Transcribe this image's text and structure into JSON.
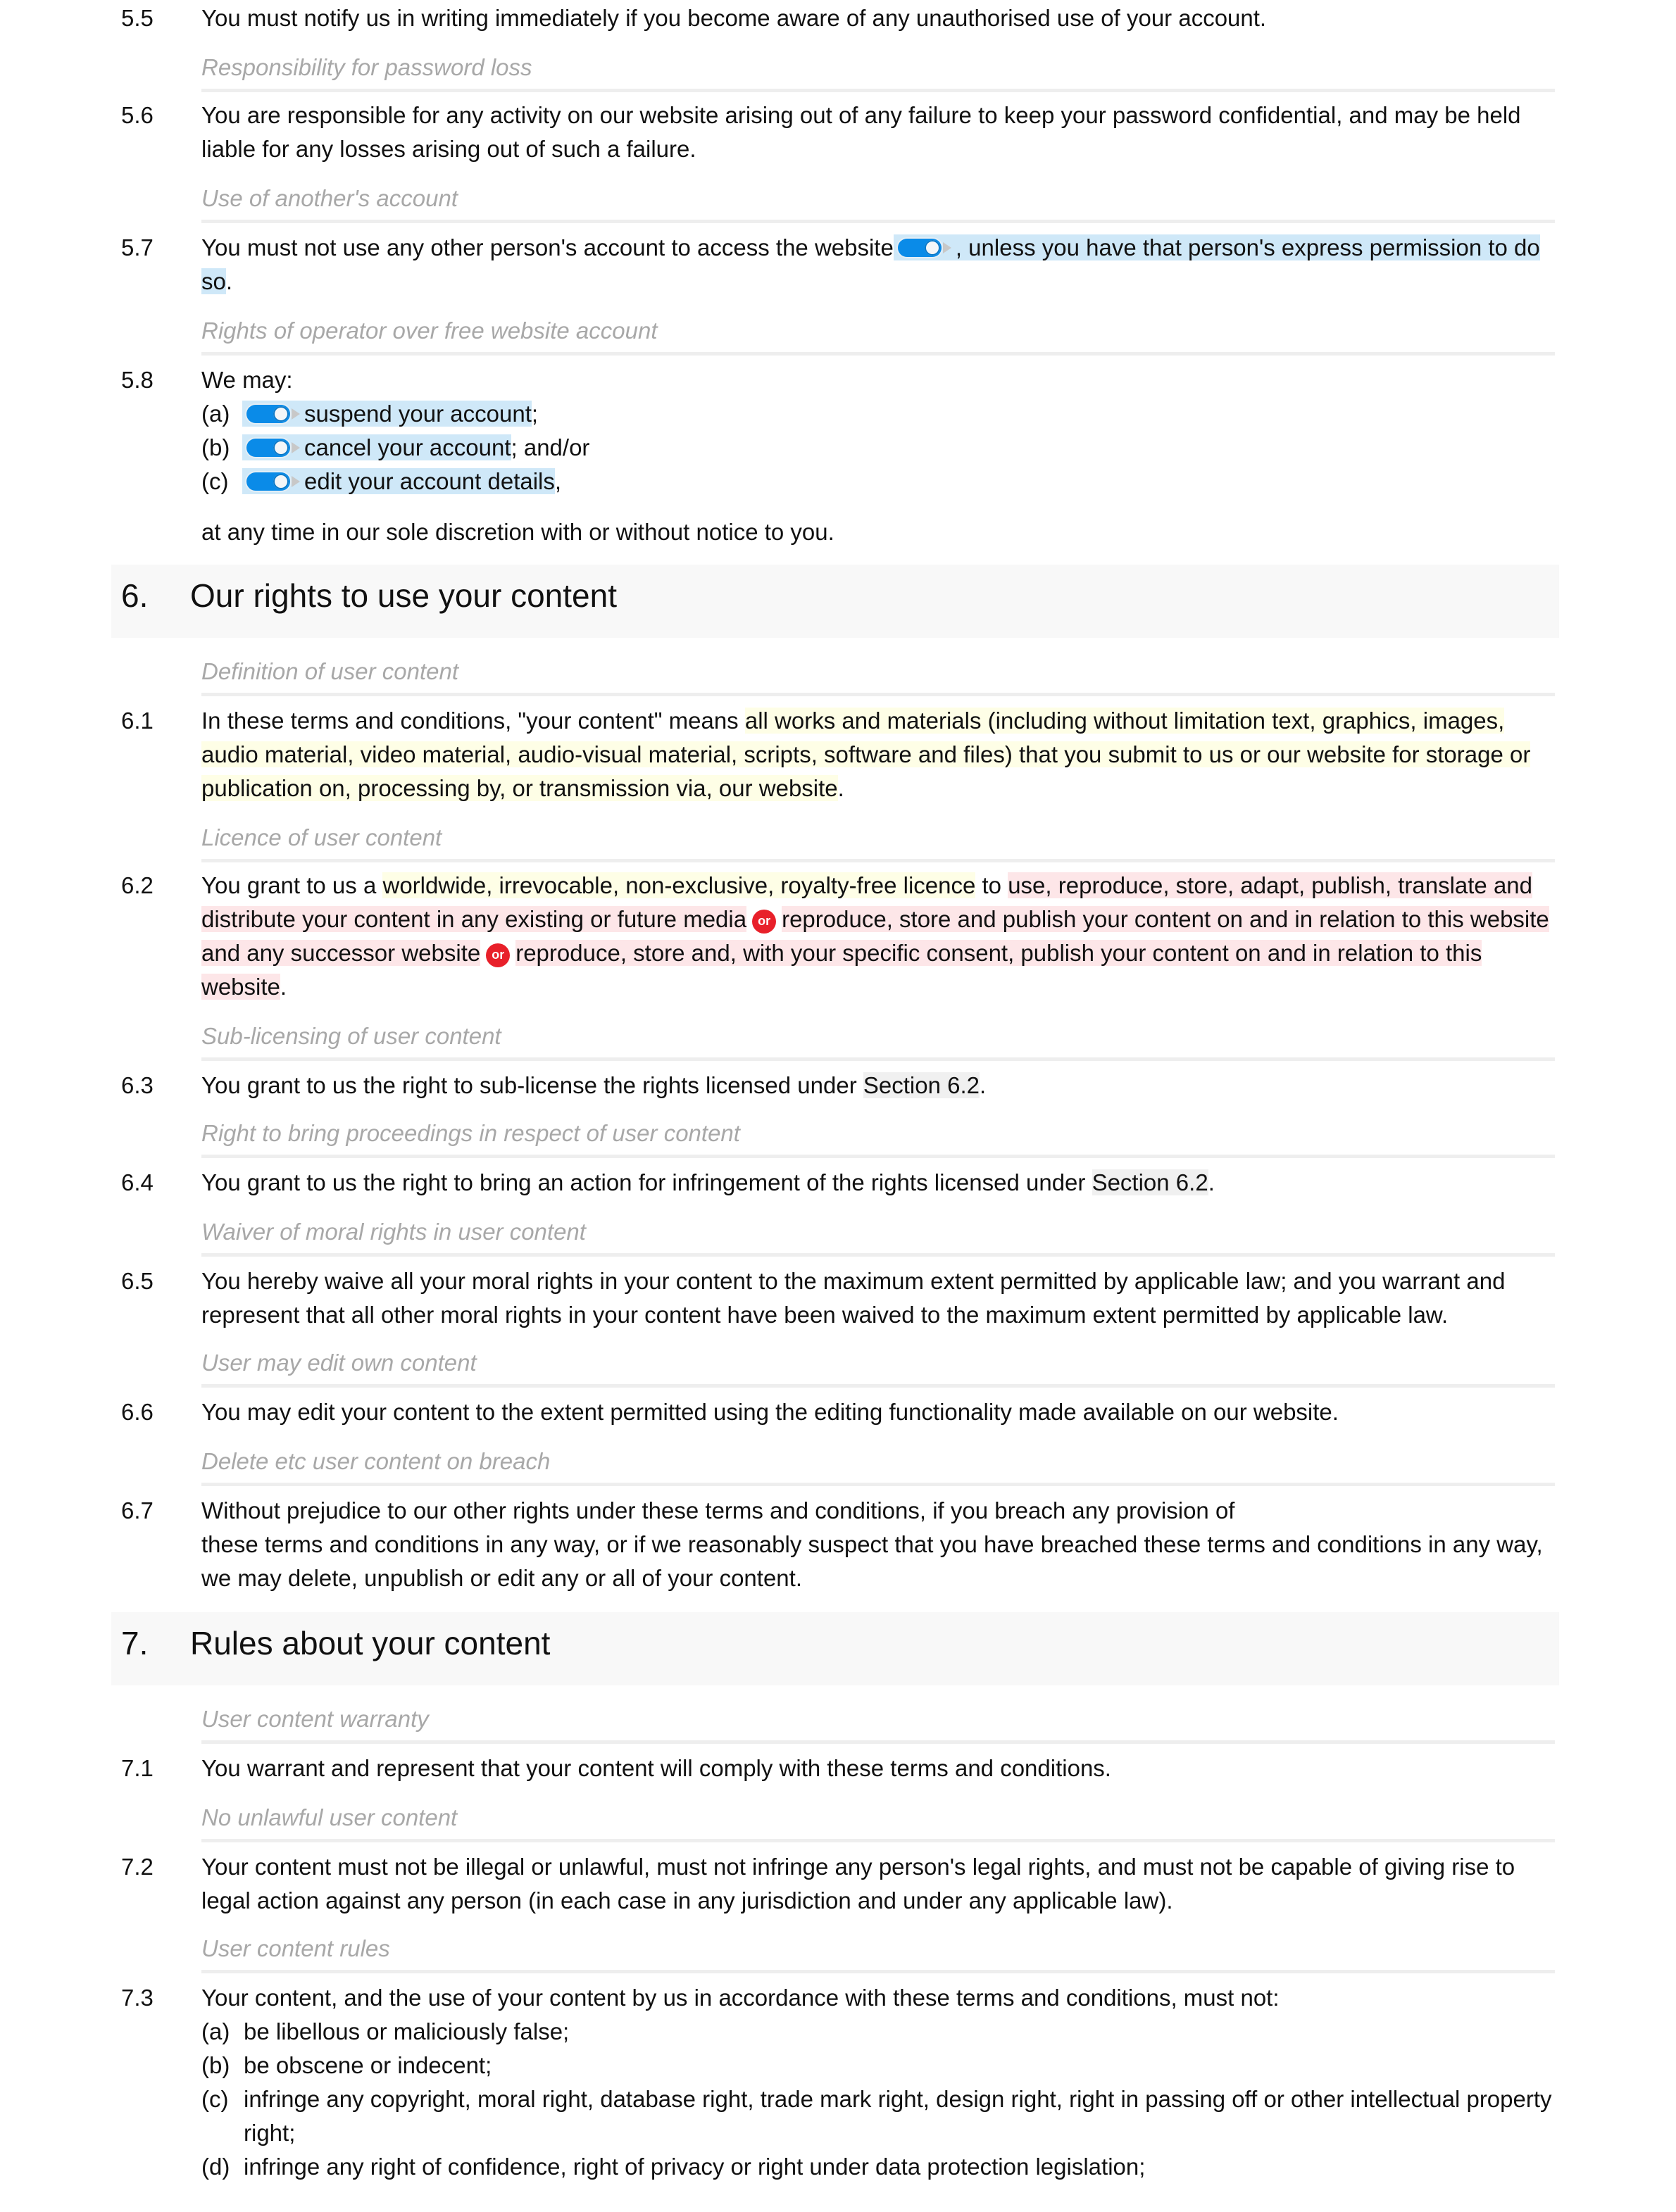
{
  "clauses_5": [
    {
      "num": "5.5",
      "text": "You must notify us in writing immediately if you become aware of any unauthorised use of your account."
    },
    {
      "subheading": "Responsibility for password loss"
    },
    {
      "num": "5.6",
      "text": "You are responsible for any activity on our website arising out of any failure to keep your password confidential, and may be held liable for any losses arising out of such a failure."
    },
    {
      "subheading": "Use of another's account"
    },
    {
      "num": "5.7",
      "text_before": "You must not use any other person's account to access the website",
      "text_optional": ", unless you have that person's express permission to do so",
      "text_after": "."
    },
    {
      "subheading": "Rights of operator over free website account"
    },
    {
      "num": "5.8",
      "intro": "We may:",
      "items": [
        {
          "label": "(a)",
          "text": "suspend your account",
          "suffix": ";"
        },
        {
          "label": "(b)",
          "text": "cancel your account",
          "suffix": "; and/or"
        },
        {
          "label": "(c)",
          "text": "edit your account details",
          "suffix": ","
        }
      ],
      "outro": "at any time in our sole discretion with or without notice to you."
    }
  ],
  "section6": {
    "num": "6.",
    "title": "Our rights to use your content"
  },
  "s6": {
    "sub1": "Definition of user content",
    "c1": {
      "num": "6.1",
      "pre": "In these terms and conditions, \"your content\" means ",
      "hl": "all works and materials (including without limitation text, graphics, images, audio material, video material, audio-visual material, scripts, software and files) that you submit to us or our website for storage or publication on, processing by, or transmission via, our website",
      "post": "."
    },
    "sub2": "Licence of user content",
    "c2": {
      "num": "6.2",
      "pre": "You grant to us a ",
      "hl1": "worldwide, irrevocable, non-exclusive, royalty-free licence",
      "mid": " to ",
      "opt1": "use, reproduce, store, adapt, publish, translate and distribute your content in any existing or future media",
      "or_label": "or",
      "opt2": "reproduce, store and publish your content on and in relation to this website and any successor website",
      "opt3": "reproduce, store and, with your specific consent, publish your content on and in relation to this website",
      "post": "."
    },
    "sub3": "Sub-licensing of user content",
    "c3": {
      "num": "6.3",
      "pre": "You grant to us the right to sub-license the rights licensed under ",
      "ref": "Section 6.2",
      "post": "."
    },
    "sub4": "Right to bring proceedings in respect of user content",
    "c4": {
      "num": "6.4",
      "pre": "You grant to us the right to bring an action for infringement of the rights licensed under ",
      "ref": "Section 6.2",
      "post": "."
    },
    "sub5": "Waiver of moral rights in user content",
    "c5": {
      "num": "6.5",
      "text": "You hereby waive all your moral rights in your content to the maximum extent permitted by applicable law; and you warrant and represent that all other moral rights in your content have been waived to the maximum extent permitted by applicable law."
    },
    "sub6": "User may edit own content",
    "c6": {
      "num": "6.6",
      "text": "You may edit your content to the extent permitted using the editing functionality made available on our website."
    },
    "sub7": "Delete etc user content on breach",
    "c7": {
      "num": "6.7",
      "line1": "Without prejudice to our other rights under these terms and conditions, if you breach any provision of",
      "line2": "these terms and conditions in any way, or if we reasonably suspect that you have breached these terms and conditions in any way, we may delete, unpublish or edit any or all of your content."
    }
  },
  "section7": {
    "num": "7.",
    "title": "Rules about your content"
  },
  "s7": {
    "sub1": "User content warranty",
    "c1": {
      "num": "7.1",
      "text": "You warrant and represent that your content will comply with these terms and conditions."
    },
    "sub2": "No unlawful user content",
    "c2": {
      "num": "7.2",
      "text": "Your content must not be illegal or unlawful, must not infringe any person's legal rights, and must not be capable of giving rise to legal action against any person (in each case in any jurisdiction and under any applicable law)."
    },
    "sub3": "User content rules",
    "c3": {
      "num": "7.3",
      "intro": "Your content, and the use of your content by us in accordance with these terms and conditions, must not:",
      "items": [
        {
          "label": "(a)",
          "text": "be libellous or maliciously false;"
        },
        {
          "label": "(b)",
          "text": "be obscene or indecent;"
        },
        {
          "label": "(c)",
          "text": "infringe any copyright, moral right, database right, trade mark right, design right, right in passing off or other intellectual property right;"
        },
        {
          "label": "(d)",
          "text": "infringe any right of confidence, right of privacy or right under data protection legislation;"
        }
      ]
    }
  },
  "colors": {
    "optional_highlight": "#cfe8f8",
    "definition_highlight": "#fefee6",
    "alternative_highlight": "#fde6e8",
    "or_badge": "#e8202a",
    "toggle_on": "#0a8be8",
    "subheading": "#a8a8a8"
  }
}
